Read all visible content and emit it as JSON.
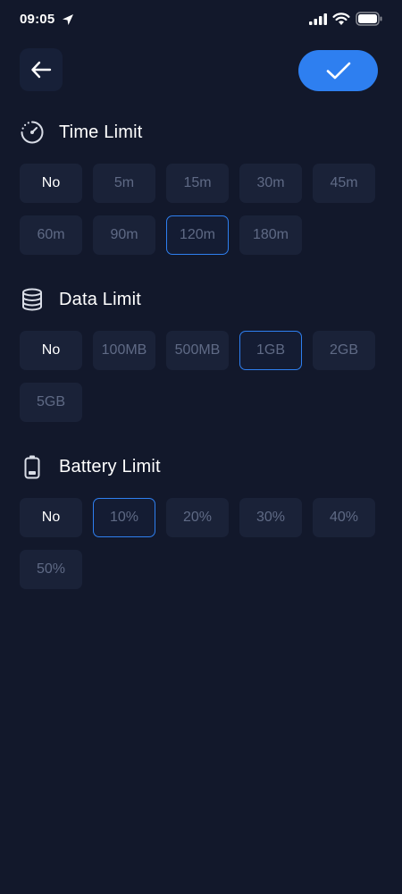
{
  "status_bar": {
    "time": "09:05"
  },
  "colors": {
    "background": "#12182b",
    "chip_background": "#1a2238",
    "accent": "#2e7ff0",
    "muted_text": "#5f6a85"
  },
  "header": {
    "back_icon": "arrow-left-icon",
    "confirm_icon": "check-icon"
  },
  "sections": {
    "time": {
      "title": "Time Limit",
      "icon": "timer-icon",
      "options": [
        "No",
        "5m",
        "15m",
        "30m",
        "45m",
        "60m",
        "90m",
        "120m",
        "180m"
      ],
      "selected": "120m"
    },
    "data": {
      "title": "Data Limit",
      "icon": "database-icon",
      "options": [
        "No",
        "100MB",
        "500MB",
        "1GB",
        "2GB",
        "5GB"
      ],
      "selected": "1GB"
    },
    "battery": {
      "title": "Battery Limit",
      "icon": "battery-icon",
      "options": [
        "No",
        "10%",
        "20%",
        "30%",
        "40%",
        "50%"
      ],
      "selected": "10%"
    }
  }
}
